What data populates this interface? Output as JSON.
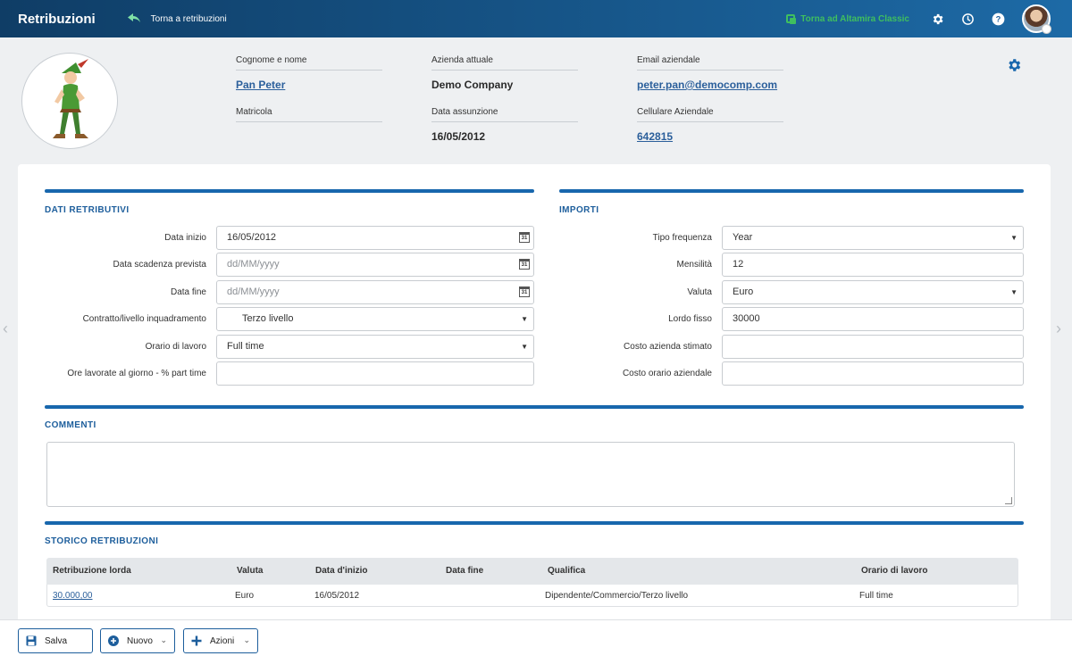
{
  "header": {
    "title": "Retribuzioni",
    "back_label": "Torna a retribuzioni",
    "classic_label": "Torna ad Altamira Classic",
    "icons": [
      "settings-icon",
      "history-icon",
      "help-icon",
      "avatar"
    ]
  },
  "employee": {
    "fullname_label": "Cognome e nome",
    "fullname": "Pan Peter",
    "matricola_label": "Matricola",
    "matricola": "",
    "company_label": "Azienda attuale",
    "company": "Demo Company",
    "hire_date_label": "Data assunzione",
    "hire_date": "16/05/2012",
    "email_label": "Email aziendale",
    "email": "peter.pan@democomp.com",
    "mobile_label": "Cellulare Aziendale",
    "mobile": "642815"
  },
  "dati": {
    "title": "DATI RETRIBUTIVI",
    "start_label": "Data inizio",
    "start_value": "16/05/2012",
    "expiry_label": "Data scadenza prevista",
    "expiry_placeholder": "dd/MM/yyyy",
    "end_label": "Data fine",
    "end_placeholder": "dd/MM/yyyy",
    "contract_label": "Contratto/livello inquadramento",
    "contract_value": "Terzo livello",
    "schedule_label": "Orario di lavoro",
    "schedule_value": "Full time",
    "hours_label": "Ore lavorate al giorno - % part time",
    "hours_value": "",
    "calendar_glyph": "31"
  },
  "importi": {
    "title": "IMPORTI",
    "frequency_label": "Tipo frequenza",
    "frequency_value": "Year",
    "months_label": "Mensilità",
    "months_value": "12",
    "currency_label": "Valuta",
    "currency_value": "Euro",
    "gross_label": "Lordo fisso",
    "gross_value": "30000",
    "company_cost_label": "Costo azienda stimato",
    "company_cost_value": "",
    "hourly_cost_label": "Costo orario aziendale",
    "hourly_cost_value": ""
  },
  "comments": {
    "title": "COMMENTI",
    "value": ""
  },
  "history": {
    "title": "STORICO RETRIBUZIONI",
    "columns": [
      "Retribuzione lorda",
      "Valuta",
      "Data d'inizio",
      "Data fine",
      "Qualifica",
      "Orario di lavoro"
    ],
    "rows": [
      {
        "gross": "30.000,00",
        "currency": "Euro",
        "start": "16/05/2012",
        "end": "",
        "qualification": "Dipendente/Commercio/Terzo livello",
        "schedule": "Full time"
      }
    ]
  },
  "toolbar": {
    "save_label": "Salva",
    "new_label": "Nuovo",
    "actions_label": "Azioni"
  },
  "colors": {
    "header_dark": "#0f3d66",
    "header_light": "#1d6aa6",
    "accent_blue": "#1867ad",
    "classic_green": "#3fbf5f",
    "link": "#2b5f9b"
  }
}
